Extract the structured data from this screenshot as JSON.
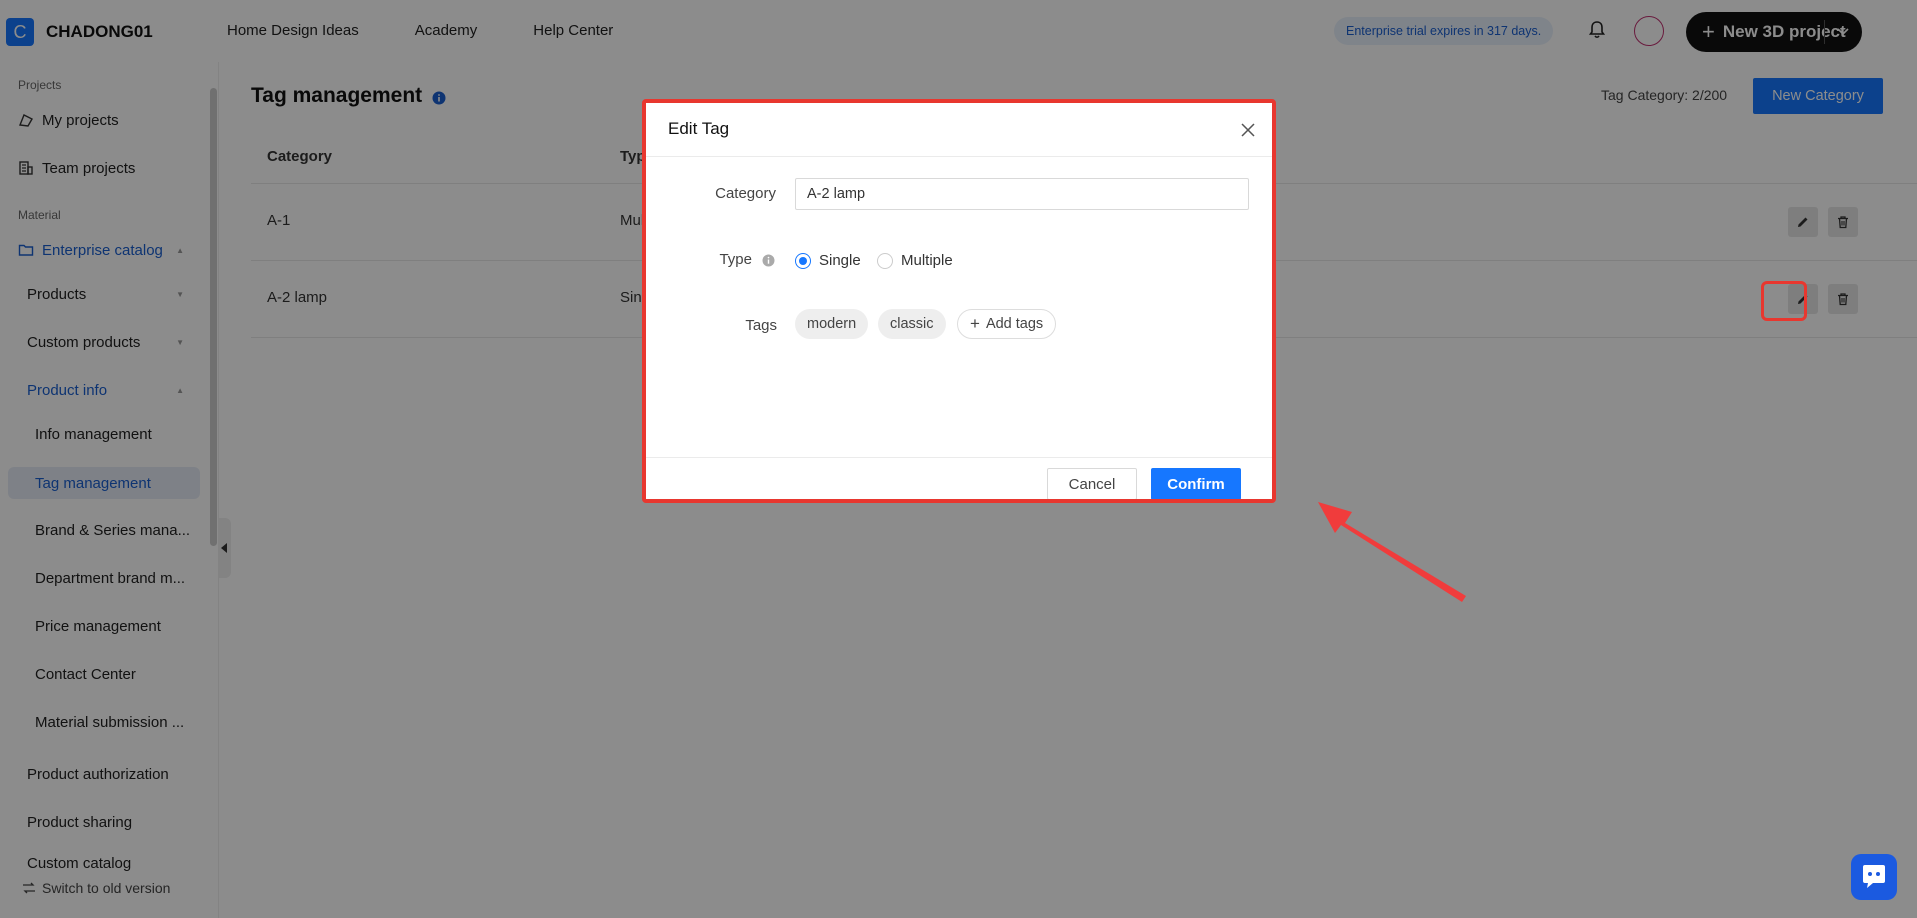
{
  "header": {
    "logo_letter": "C",
    "brand": "CHADONG01",
    "nav": [
      "Home Design Ideas",
      "Academy",
      "Help Center"
    ],
    "trial_text": "Enterprise trial expires in 317 days.",
    "new_project_label": "New 3D project"
  },
  "sidebar": {
    "group_projects": "Projects",
    "my_projects": "My projects",
    "team_projects": "Team projects",
    "group_material": "Material",
    "enterprise_catalog": "Enterprise catalog",
    "products": "Products",
    "custom_products": "Custom products",
    "product_info": "Product info",
    "info_management": "Info management",
    "tag_management": "Tag management",
    "brand_series": "Brand & Series mana...",
    "department_brand": "Department brand m...",
    "price_management": "Price management",
    "contact_center": "Contact Center",
    "material_submission": "Material submission ...",
    "product_authorization": "Product authorization",
    "product_sharing": "Product sharing",
    "custom_catalog": "Custom catalog",
    "switch_old": "Switch to old version"
  },
  "main": {
    "title": "Tag management",
    "tag_count": "Tag Category: 2/200",
    "new_category": "New Category",
    "columns": [
      "Category",
      "Type"
    ],
    "rows": [
      {
        "category": "A-1",
        "type": "Multip"
      },
      {
        "category": "A-2 lamp",
        "type": "Single"
      }
    ]
  },
  "modal": {
    "title": "Edit Tag",
    "category_label": "Category",
    "category_value": "A-2 lamp",
    "type_label": "Type",
    "type_options": [
      "Single",
      "Multiple"
    ],
    "type_selected": "Single",
    "tags_label": "Tags",
    "tags": [
      "modern",
      "classic"
    ],
    "add_tags": "Add tags",
    "cancel": "Cancel",
    "confirm": "Confirm"
  },
  "colors": {
    "accent": "#1677ff",
    "highlight": "#e8372f"
  }
}
